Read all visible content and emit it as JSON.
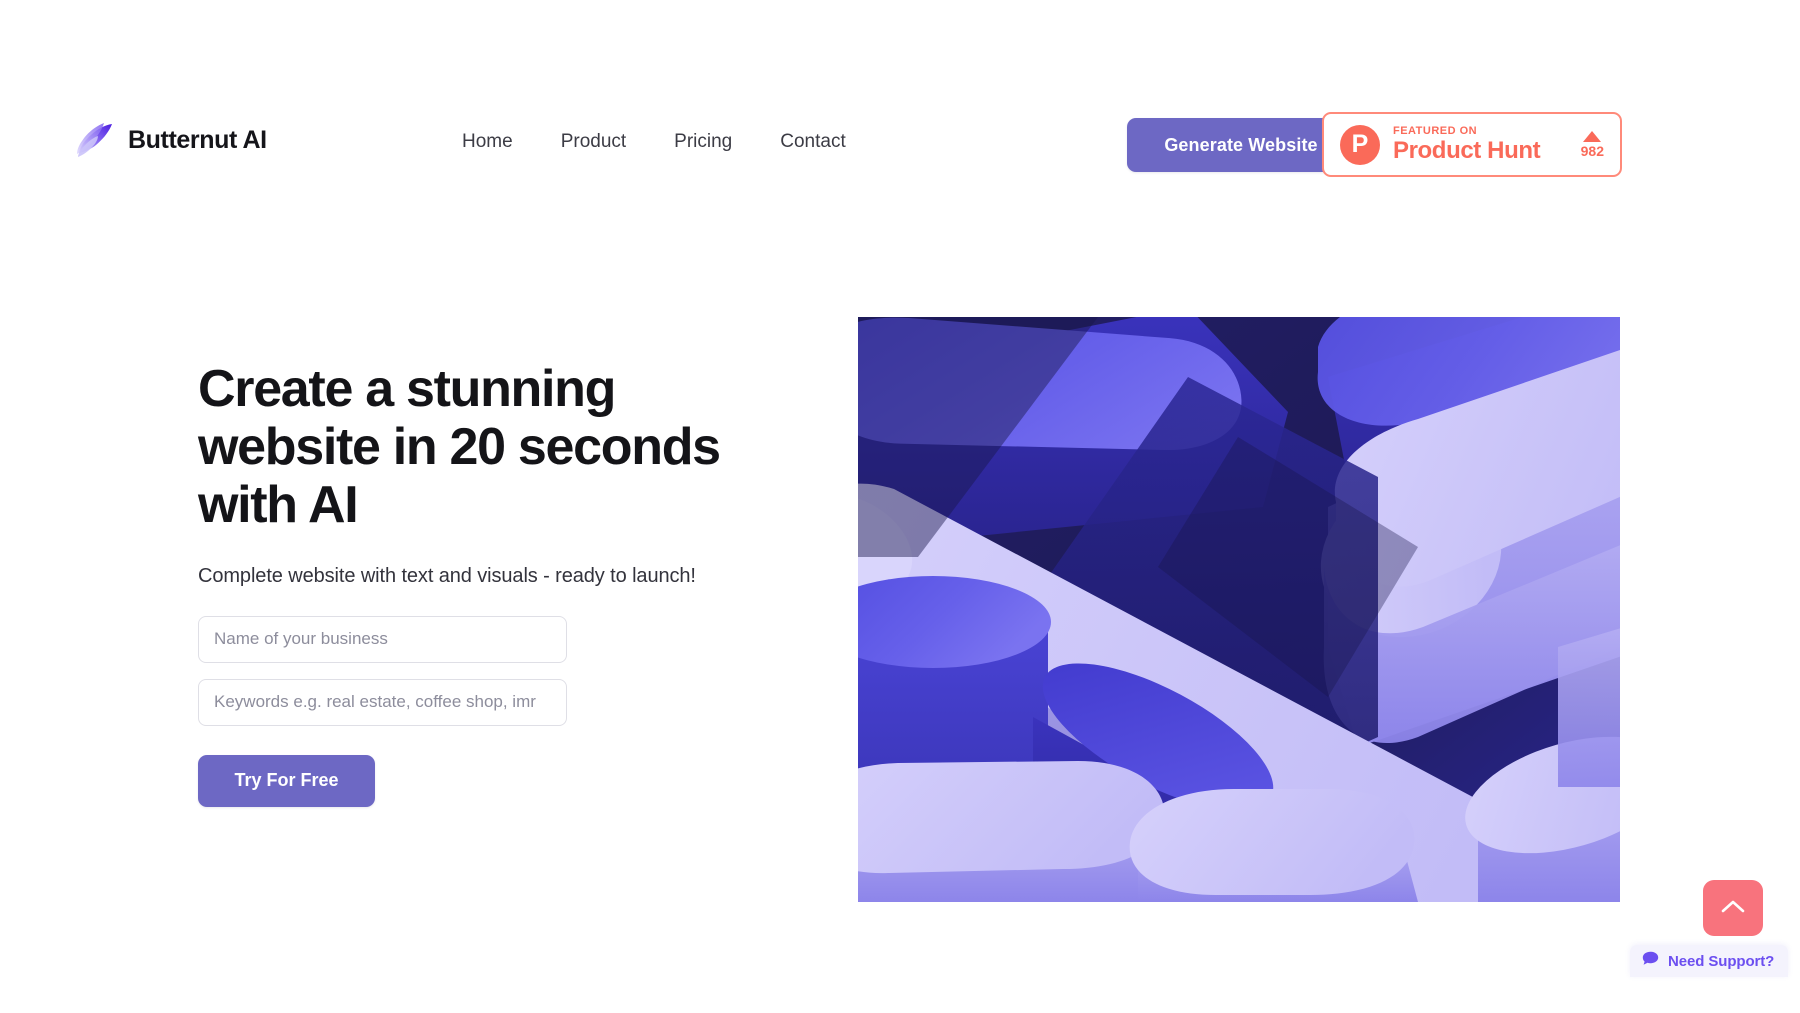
{
  "header": {
    "brand": {
      "name": "Butternut AI",
      "logo_icon": "feather-logo-icon"
    },
    "nav": [
      {
        "label": "Home"
      },
      {
        "label": "Product"
      },
      {
        "label": "Pricing"
      },
      {
        "label": "Contact"
      }
    ],
    "generate_button": {
      "label": "Generate Website"
    },
    "product_hunt_badge": {
      "kicker": "FEATURED ON",
      "title": "Product Hunt",
      "upvotes": "982",
      "logo_letter": "P",
      "upvote_icon": "caret-up-icon",
      "accent_color": "#fa6a59",
      "border_color": "#ff8a7a"
    },
    "accent_color": "#6d68c4"
  },
  "hero": {
    "title": "Create a stunning website in 20 seconds with AI",
    "subtitle": "Complete website with text and visuals - ready to launch!",
    "business_input": {
      "placeholder": "Name of your business",
      "value": ""
    },
    "keywords_input": {
      "placeholder": "Keywords e.g. real estate, coffee shop, imr",
      "value": ""
    },
    "cta_button": {
      "label": "Try For Free"
    },
    "visual": {
      "alt": "abstract 3d rounded bars render",
      "colors": {
        "dark_navy": "#221f62",
        "deep_blue": "#2e2ba0",
        "royal_blue": "#3b39c9",
        "indigo": "#4f49db",
        "periwinkle": "#635ce8",
        "light_lavender": "#b9b3f2",
        "pale_lavender": "#cdc8f7",
        "lightest": "#ddd9fb"
      }
    }
  },
  "floating": {
    "scroll_top": {
      "icon": "chevron-up-icon",
      "color": "#f8737d"
    },
    "support": {
      "label": "Need Support?",
      "icon": "chat-bubble-icon",
      "color": "#6c4ff0"
    }
  }
}
